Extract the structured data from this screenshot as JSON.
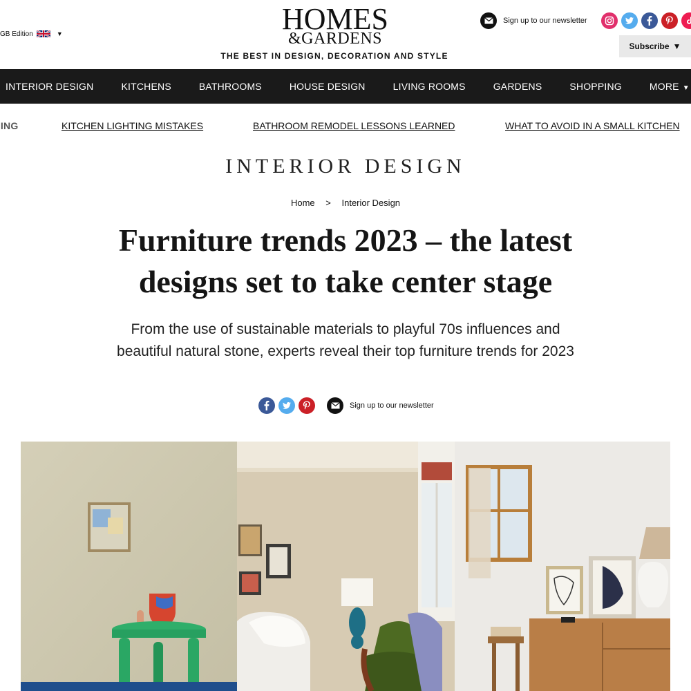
{
  "header": {
    "edition_label": "GB Edition",
    "logo_line1": "HOMES",
    "logo_line2": "&GARDENS",
    "tagline": "THE BEST IN DESIGN, DECORATION AND STYLE",
    "newsletter_label": "Sign up to our newsletter",
    "subscribe_label": "Subscribe",
    "socials": [
      "instagram-icon",
      "twitter-icon",
      "facebook-icon",
      "pinterest-icon",
      "tiktok-icon"
    ]
  },
  "nav": {
    "items": [
      "INTERIOR DESIGN",
      "KITCHENS",
      "BATHROOMS",
      "HOUSE DESIGN",
      "LIVING ROOMS",
      "GARDENS",
      "SHOPPING",
      "MORE"
    ]
  },
  "trending": {
    "label": "NDING",
    "links": [
      "KITCHEN LIGHTING MISTAKES",
      "BATHROOM REMODEL LESSONS LEARNED",
      "WHAT TO AVOID IN A SMALL KITCHEN"
    ]
  },
  "article": {
    "section": "INTERIOR DESIGN",
    "breadcrumb": {
      "home": "Home",
      "separator": ">",
      "current": "Interior Design"
    },
    "headline": "Furniture trends 2023 – the latest designs set to take center stage",
    "standfirst": "From the use of sustainable materials to playful 70s influences and beautiful natural stone, experts reveal their top furniture trends for 2023",
    "share_newsletter_label": "Sign up to our newsletter"
  },
  "colors": {
    "nav_bg": "#1a1a1a",
    "facebook": "#3b5998",
    "twitter": "#55acee",
    "pinterest": "#cb2027",
    "instagram": "#e1306c",
    "tiktok": "#ee1d52"
  }
}
